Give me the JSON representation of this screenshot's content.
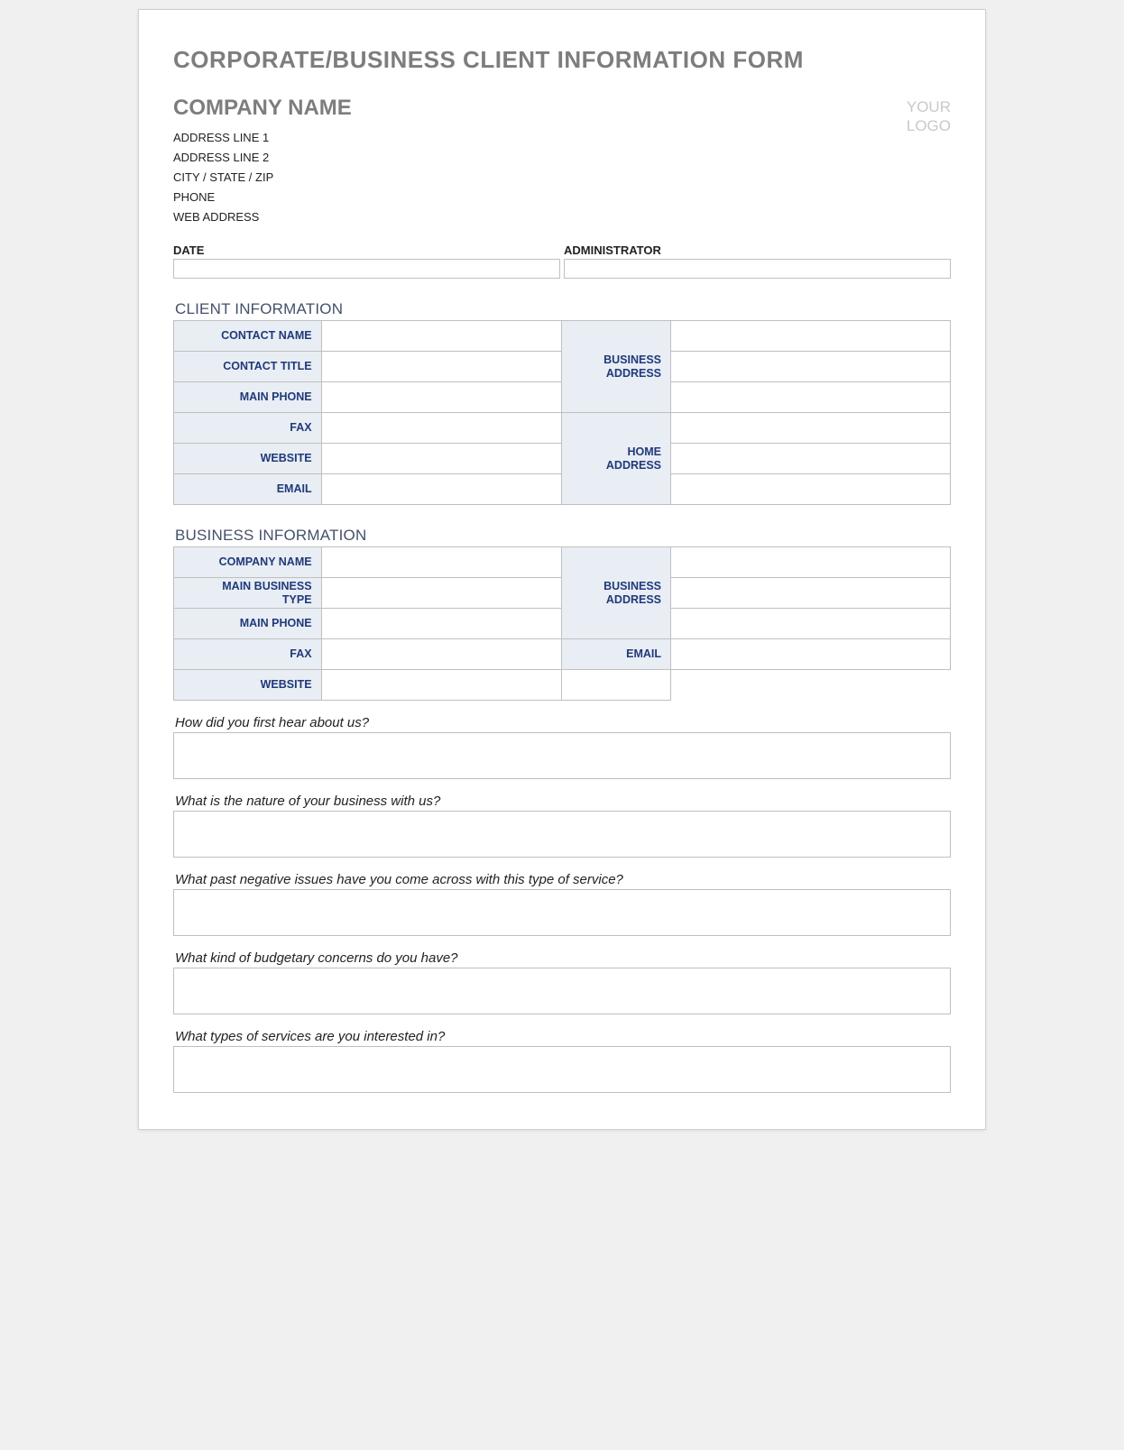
{
  "formTitle": "CORPORATE/BUSINESS CLIENT INFORMATION FORM",
  "company": {
    "name": "COMPANY NAME",
    "addr1": "ADDRESS LINE 1",
    "addr2": "ADDRESS LINE 2",
    "cityStateZip": "CITY / STATE / ZIP",
    "phone": "PHONE",
    "web": "WEB ADDRESS"
  },
  "logo": {
    "line1": "YOUR",
    "line2": "LOGO"
  },
  "meta": {
    "dateLabel": "DATE",
    "adminLabel": "ADMINISTRATOR"
  },
  "sections": {
    "client": "CLIENT INFORMATION",
    "business": "BUSINESS INFORMATION"
  },
  "clientLabels": {
    "contactName": "CONTACT NAME",
    "contactTitle": "CONTACT TITLE",
    "mainPhone": "MAIN PHONE",
    "fax": "FAX",
    "website": "WEBSITE",
    "email": "EMAIL",
    "businessAddress": "BUSINESS\nADDRESS",
    "homeAddress": "HOME\nADDRESS"
  },
  "businessLabels": {
    "companyName": "COMPANY NAME",
    "mainBusinessType": "MAIN BUSINESS\nTYPE",
    "mainPhone": "MAIN PHONE",
    "fax": "FAX",
    "website": "WEBSITE",
    "email": "EMAIL",
    "businessAddress": "BUSINESS\nADDRESS"
  },
  "questions": {
    "q1": "How did you first hear about us?",
    "q2": "What is the nature of your business with us?",
    "q3": "What past negative issues have you come across with this type of service?",
    "q4": "What kind of budgetary concerns do you have?",
    "q5": "What types of services are you interested in?"
  }
}
